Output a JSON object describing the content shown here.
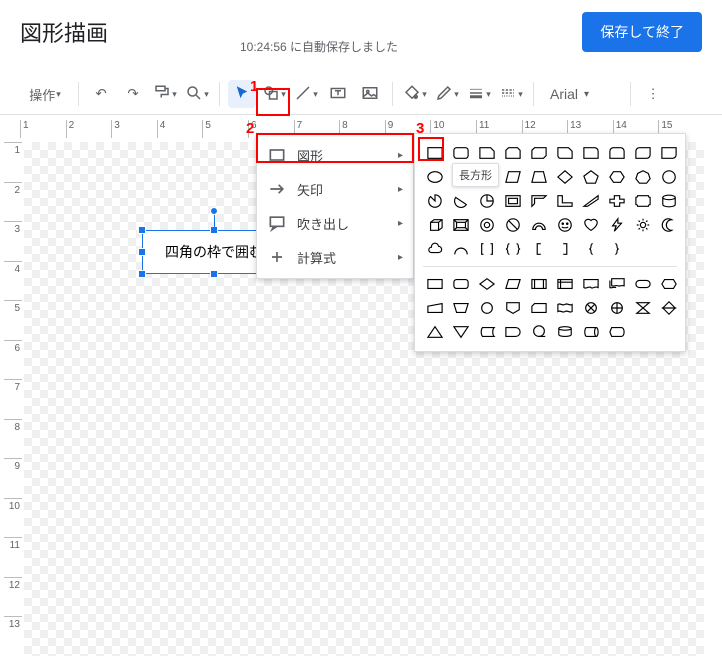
{
  "header": {
    "title": "図形描画",
    "autosave": "10:24:56 に自動保存しました",
    "save_close": "保存して終了"
  },
  "toolbar": {
    "actions_label": "操作",
    "font": "Arial"
  },
  "annotations": {
    "n1": "1",
    "n2": "2",
    "n3": "3"
  },
  "textbox": {
    "text": "四角の枠で囲む"
  },
  "submenu": {
    "shapes": "図形",
    "arrows": "矢印",
    "callouts": "吹き出し",
    "equation": "計算式"
  },
  "tooltip": {
    "rectangle": "長方形"
  },
  "hruler": [
    "1",
    "2",
    "3",
    "4",
    "5",
    "6",
    "7",
    "8",
    "9",
    "10",
    "11",
    "12",
    "13",
    "14",
    "15"
  ],
  "vruler": [
    "1",
    "2",
    "3",
    "4",
    "5",
    "6",
    "7",
    "8",
    "9",
    "10",
    "11",
    "12",
    "13"
  ]
}
